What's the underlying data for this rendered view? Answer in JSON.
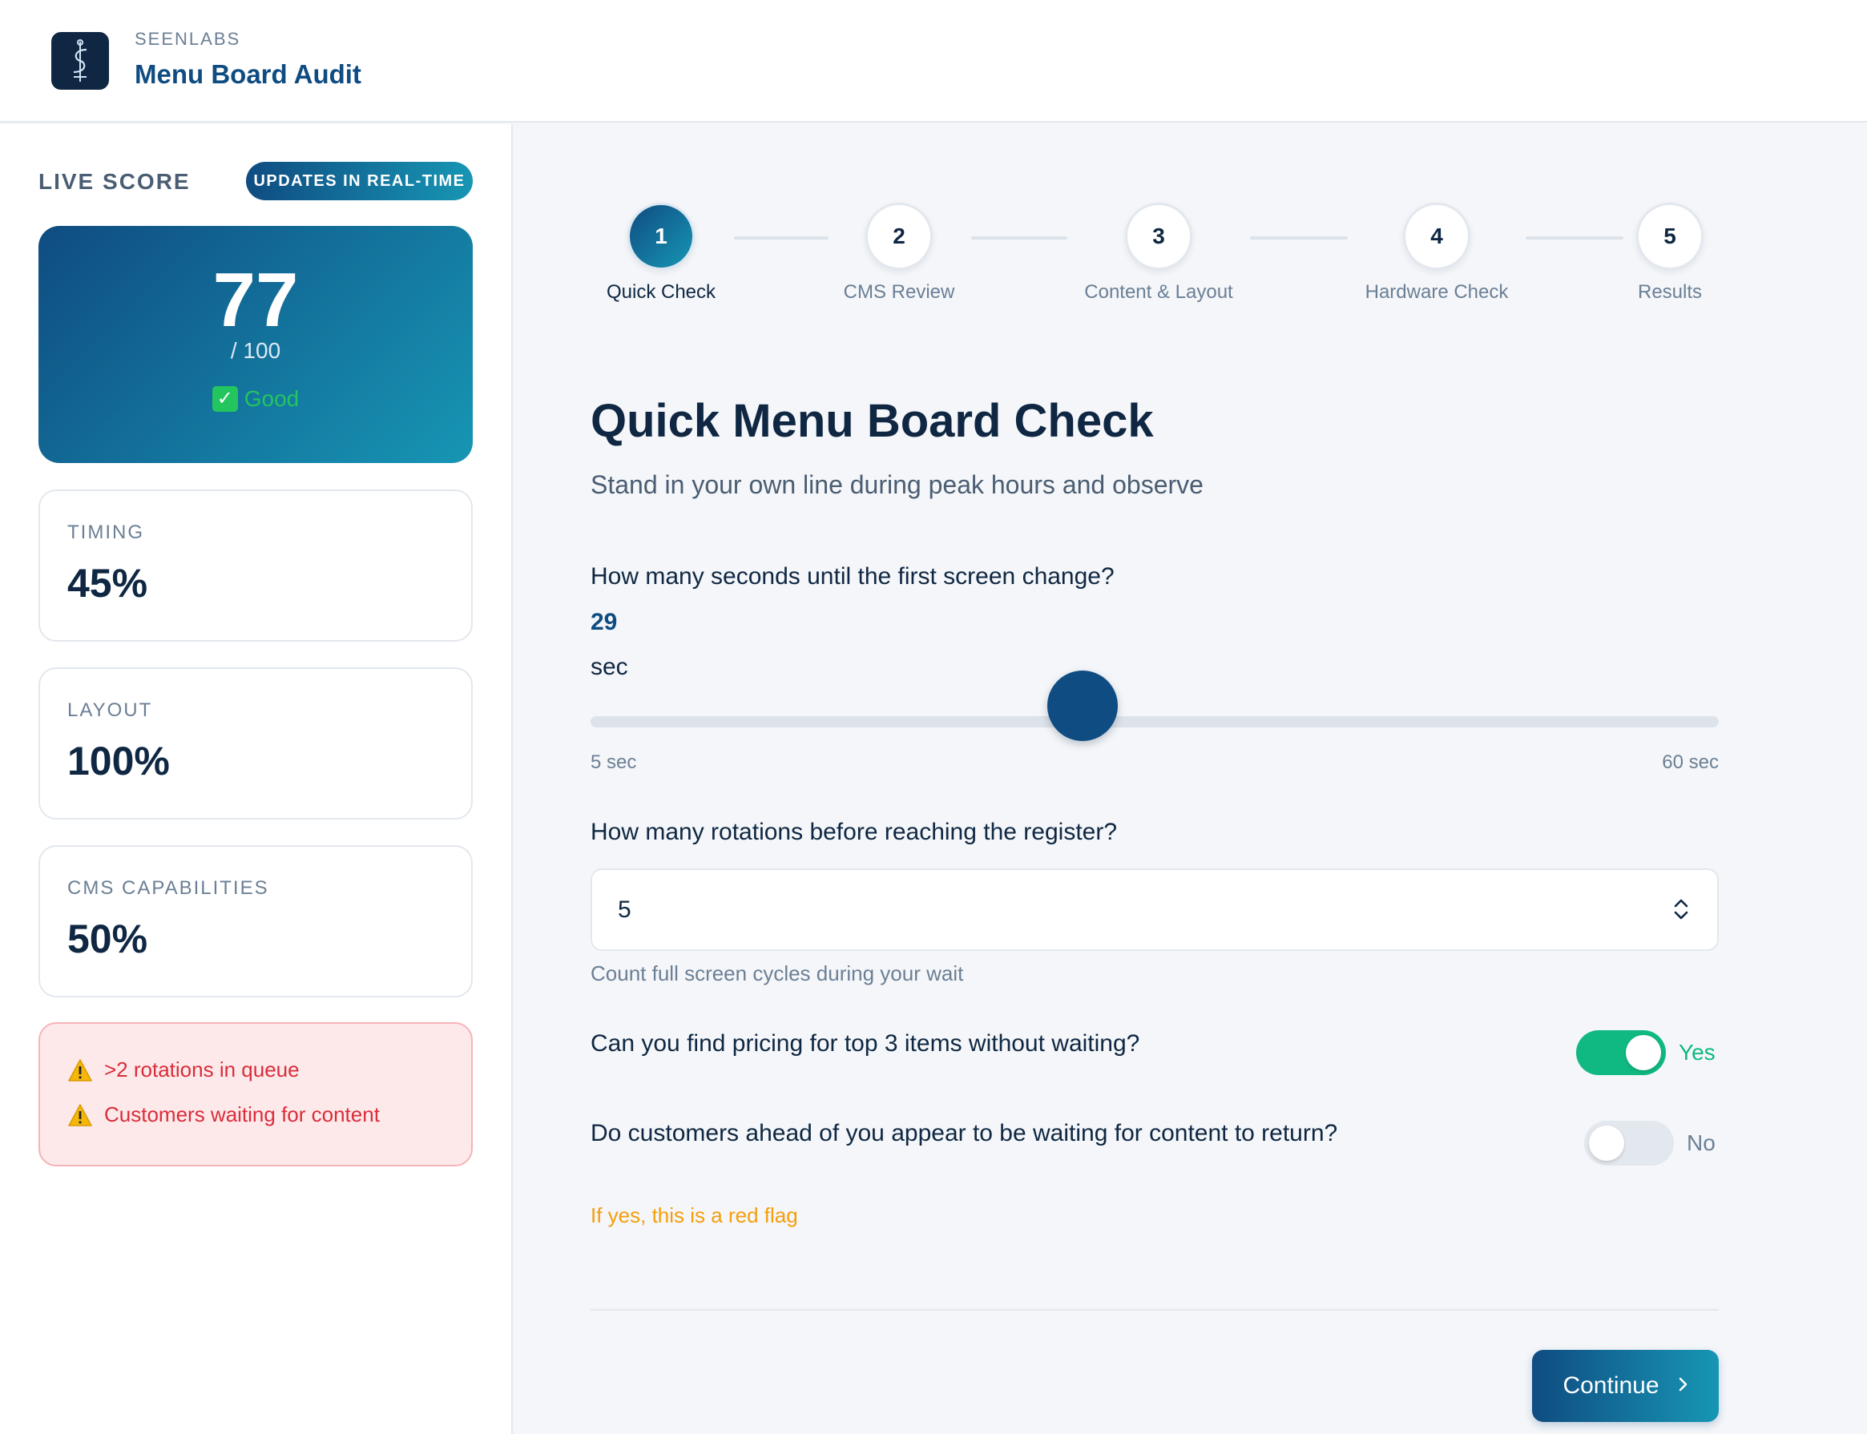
{
  "header": {
    "brand": "SEENLABS",
    "title": "Menu Board Audit",
    "logo_icon": "caduceus-icon"
  },
  "sidebar": {
    "live_label": "LIVE SCORE",
    "realtime_badge": "UPDATES IN REAL-TIME",
    "score": {
      "value": "77",
      "max": "/ 100",
      "status": "Good",
      "status_icon": "check-icon"
    },
    "metrics": [
      {
        "label": "TIMING",
        "value": "45%"
      },
      {
        "label": "LAYOUT",
        "value": "100%"
      },
      {
        "label": "CMS CAPABILITIES",
        "value": "50%"
      }
    ],
    "alerts": [
      {
        "text": ">2 rotations in queue",
        "icon": "warning-icon"
      },
      {
        "text": "Customers waiting for content",
        "icon": "warning-icon"
      }
    ]
  },
  "stepper": {
    "current": 1,
    "steps": [
      {
        "number": "1",
        "label": "Quick Check"
      },
      {
        "number": "2",
        "label": "CMS Review"
      },
      {
        "number": "3",
        "label": "Content & Layout"
      },
      {
        "number": "4",
        "label": "Hardware Check"
      },
      {
        "number": "5",
        "label": "Results"
      }
    ]
  },
  "form": {
    "title": "Quick Menu Board Check",
    "subtitle": "Stand in your own line during peak hours and observe",
    "q1": {
      "question": "How many seconds until the first screen change?",
      "value": "29",
      "unit": "sec",
      "min_label": "5 sec",
      "max_label": "60 sec",
      "min": 5,
      "max": 60,
      "current": 29
    },
    "q2": {
      "question": "How many rotations before reaching the register?",
      "value": "5",
      "hint": "Count full screen cycles during your wait"
    },
    "q3": {
      "question": "Can you find pricing for top 3 items without waiting?",
      "state": true,
      "state_label": "Yes"
    },
    "q4": {
      "question": "Do customers ahead of you appear to be waiting for content to return?",
      "state": false,
      "state_label": "No",
      "hint": "If yes, this is a red flag"
    },
    "continue_label": "Continue"
  },
  "colors": {
    "primary": "#0f4c81",
    "accent": "#1796b4",
    "success": "#10b981",
    "danger": "#d92d3a",
    "warning": "#f59e0b"
  }
}
